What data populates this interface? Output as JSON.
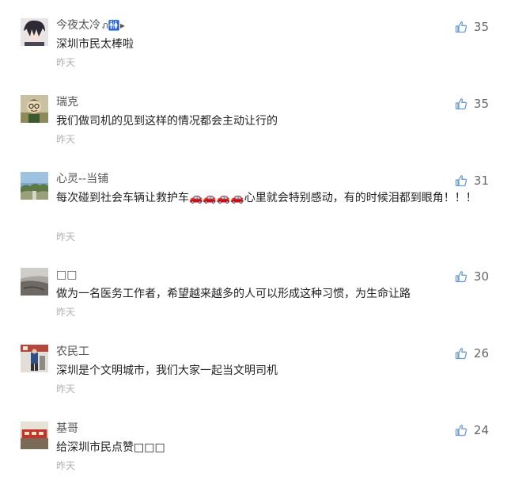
{
  "comments": [
    {
      "user": "今夜太冷",
      "flag": "ภ🚻▸",
      "content": "深圳市民太棒啦",
      "time": "昨天",
      "likes": "35",
      "avatar_icon": "avatar-anime-boy"
    },
    {
      "user": "瑞克",
      "flag": "",
      "content": "我们做司机的见到这样的情况都会主动让行的",
      "time": "昨天",
      "likes": "35",
      "avatar_icon": "avatar-cartoon"
    },
    {
      "user": "心灵--当铺",
      "flag": "",
      "content": "每次碰到社会车辆让救护车🚗🚗🚗🚗心里就会特别感动，有的时候泪都到眼角！！！",
      "time": "昨天",
      "likes": "31",
      "avatar_icon": "avatar-landscape"
    },
    {
      "user": "□□",
      "flag": "",
      "content": "做为一名医务工作者，希望越来越多的人可以形成这种习惯，为生命让路",
      "time": "昨天",
      "likes": "30",
      "avatar_icon": "avatar-gray-scene"
    },
    {
      "user": "农民工",
      "flag": "",
      "content": "深圳是个文明城市，我们大家一起当文明司机",
      "time": "昨天",
      "likes": "26",
      "avatar_icon": "avatar-street-photo"
    },
    {
      "user": "基哥",
      "flag": "",
      "content": "给深圳市民点赞□□□",
      "time": "昨天",
      "likes": "24",
      "avatar_icon": "avatar-red-banner"
    }
  ],
  "colors": {
    "like_icon": "#6a9bd2",
    "time": "#b0b0b0",
    "username": "#555555"
  }
}
